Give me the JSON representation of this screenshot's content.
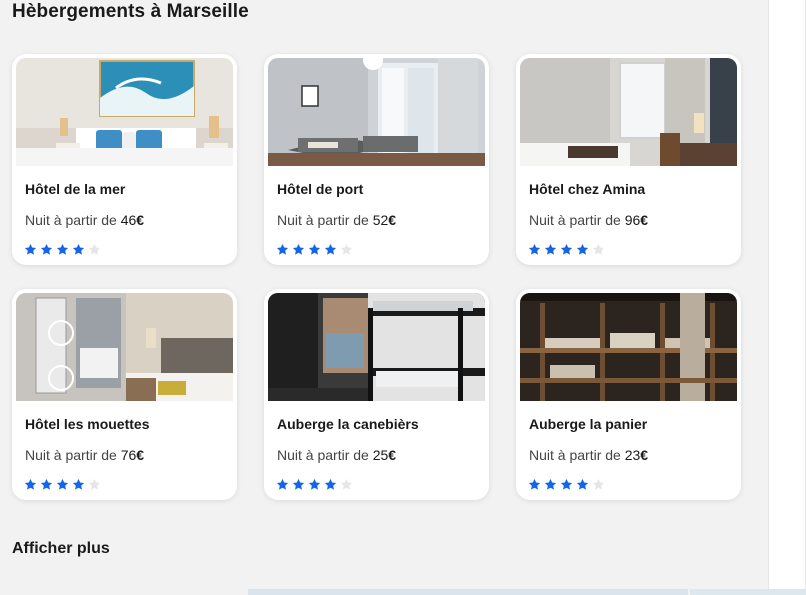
{
  "page": {
    "title": "Hèbergements à Marseille",
    "more_label": "Afficher plus"
  },
  "colors": {
    "accent": "#1565e8",
    "star_empty": "#e6e6e6"
  },
  "price_prefix": "Nuit à partir de",
  "currency": "€",
  "listings": [
    {
      "name": "Hôtel de la mer",
      "price": "46",
      "rating": 4,
      "max_rating": 5,
      "image": "hotel-room-blue-art"
    },
    {
      "name": "Hôtel de port",
      "price": "52",
      "rating": 4,
      "max_rating": 5,
      "image": "hotel-room-twin-beds"
    },
    {
      "name": "Hôtel chez Amina",
      "price": "96",
      "rating": 4,
      "max_rating": 5,
      "image": "hotel-room-window"
    },
    {
      "name": "Hôtel les mouettes",
      "price": "76",
      "rating": 4,
      "max_rating": 5,
      "image": "hotel-room-headboard"
    },
    {
      "name": "Auberge la canebièrs",
      "price": "25",
      "rating": 4,
      "max_rating": 5,
      "image": "hostel-bunk-beds"
    },
    {
      "name": "Auberge la panier",
      "price": "23",
      "rating": 4,
      "max_rating": 5,
      "image": "hostel-wood-bunks"
    }
  ]
}
